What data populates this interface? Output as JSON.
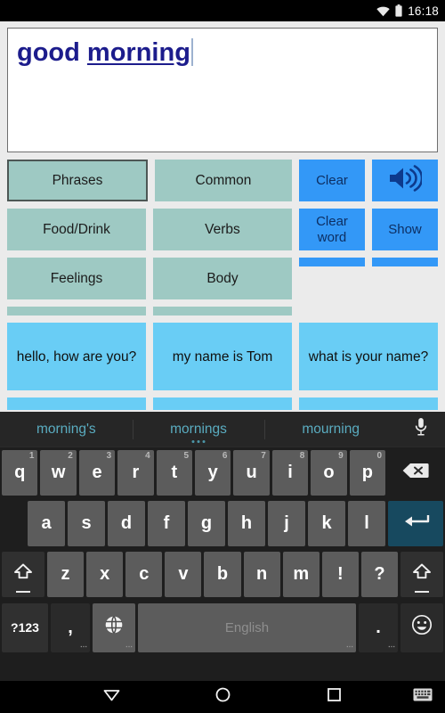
{
  "status_bar": {
    "time": "16:18",
    "icons": [
      "wifi-icon",
      "battery-icon"
    ]
  },
  "editor": {
    "committed_text": "good ",
    "composing_text": "morning",
    "text_color": "#1c1c8c",
    "caret_visible": true
  },
  "categories": {
    "rows": [
      [
        {
          "label": "Phrases",
          "selected": true
        },
        {
          "label": "Common",
          "selected": false
        }
      ],
      [
        {
          "label": "Food/Drink",
          "selected": false
        },
        {
          "label": "Verbs",
          "selected": false
        }
      ],
      [
        {
          "label": "Feelings",
          "selected": false
        },
        {
          "label": "Body",
          "selected": false
        }
      ]
    ],
    "color": "#9ec9c3",
    "selected_border": "#4d5755"
  },
  "actions": {
    "rows": [
      [
        {
          "label": "Clear",
          "icon": null
        },
        {
          "label": "",
          "icon": "speaker-icon"
        }
      ],
      [
        {
          "label": "Clear word",
          "icon": null
        },
        {
          "label": "Show",
          "icon": null
        }
      ]
    ],
    "color": "#3398f7",
    "text_color": "#0d2f63"
  },
  "phrases": {
    "items": [
      "hello, how are you?",
      "my name is Tom",
      "what is your name?"
    ],
    "color": "#69cdf5"
  },
  "keyboard": {
    "suggestions": [
      {
        "text": "morning's",
        "active": false
      },
      {
        "text": "mornings",
        "active": true
      },
      {
        "text": "mourning",
        "active": false
      }
    ],
    "mic_icon": "microphone-icon",
    "suggestion_color": "#5aacc0",
    "row1": [
      {
        "key": "q",
        "hint": "1"
      },
      {
        "key": "w",
        "hint": "2"
      },
      {
        "key": "e",
        "hint": "3"
      },
      {
        "key": "r",
        "hint": "4"
      },
      {
        "key": "t",
        "hint": "5"
      },
      {
        "key": "y",
        "hint": "6"
      },
      {
        "key": "u",
        "hint": "7"
      },
      {
        "key": "i",
        "hint": "8"
      },
      {
        "key": "o",
        "hint": "9"
      },
      {
        "key": "p",
        "hint": "0"
      }
    ],
    "backspace_icon": "backspace-icon",
    "row2": [
      "a",
      "s",
      "d",
      "f",
      "g",
      "h",
      "j",
      "k",
      "l"
    ],
    "enter_icon": "enter-icon",
    "row3": [
      "z",
      "x",
      "c",
      "v",
      "b",
      "n",
      "m",
      "!",
      "?"
    ],
    "shift_icon": "shift-icon",
    "row4": {
      "symbols_label": "?123",
      "comma_label": ",",
      "globe_icon": "globe-icon",
      "space_label": "English",
      "period_label": ".",
      "emoji_icon": "emoji-icon"
    }
  },
  "nav_bar": {
    "back_icon": "back-triangle-icon",
    "home_icon": "home-circle-icon",
    "recents_icon": "recents-square-icon",
    "keyboard_icon": "keyboard-toggle-icon"
  }
}
